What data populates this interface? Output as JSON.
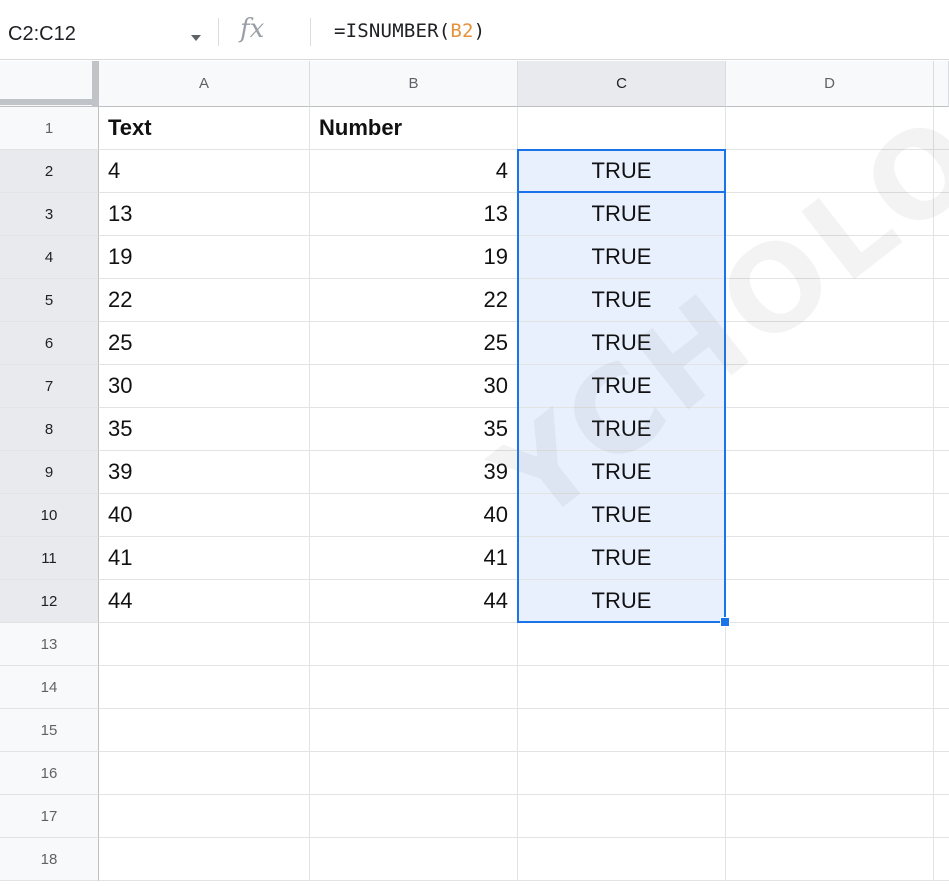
{
  "formula_bar": {
    "name_box": "C2:C12",
    "fx_symbol": "fx",
    "formula_prefix": "=ISNUMBER(",
    "formula_ref": "B2",
    "formula_suffix": ")"
  },
  "columns": [
    "A",
    "B",
    "C",
    "D"
  ],
  "rows": [
    "1",
    "2",
    "3",
    "4",
    "5",
    "6",
    "7",
    "8",
    "9",
    "10",
    "11",
    "12",
    "13",
    "14",
    "15",
    "16",
    "17",
    "18"
  ],
  "cells": {
    "A": [
      "Text",
      "4",
      "13",
      "19",
      "22",
      "25",
      "30",
      "35",
      "39",
      "40",
      "41",
      "44"
    ],
    "B": [
      "Number",
      "4",
      "13",
      "19",
      "22",
      "25",
      "30",
      "35",
      "39",
      "40",
      "41",
      "44"
    ],
    "C": [
      "",
      "TRUE",
      "TRUE",
      "TRUE",
      "TRUE",
      "TRUE",
      "TRUE",
      "TRUE",
      "TRUE",
      "TRUE",
      "TRUE",
      "TRUE"
    ]
  },
  "selection": {
    "range": "C2:C12",
    "active_cell": "C2"
  },
  "watermark": "YCHOLOGY",
  "colors": {
    "selection": "#1a73e8",
    "selection_fill": "#e8f0fe",
    "formula_ref": "#e8913c"
  }
}
